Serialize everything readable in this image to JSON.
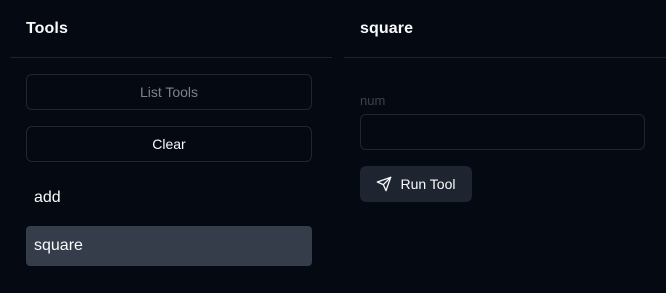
{
  "tools_panel": {
    "title": "Tools",
    "list_tools_label": "List Tools",
    "clear_label": "Clear",
    "items": [
      {
        "label": "add",
        "selected": false
      },
      {
        "label": "square",
        "selected": true
      }
    ]
  },
  "detail_panel": {
    "title": "square",
    "field": {
      "label": "num",
      "value": ""
    },
    "run_label": "Run Tool",
    "run_icon": "send-icon"
  },
  "colors": {
    "background": "#050911",
    "selected_item": "#353d4a",
    "button_bg": "#1f2530",
    "border": "#1f2633"
  }
}
